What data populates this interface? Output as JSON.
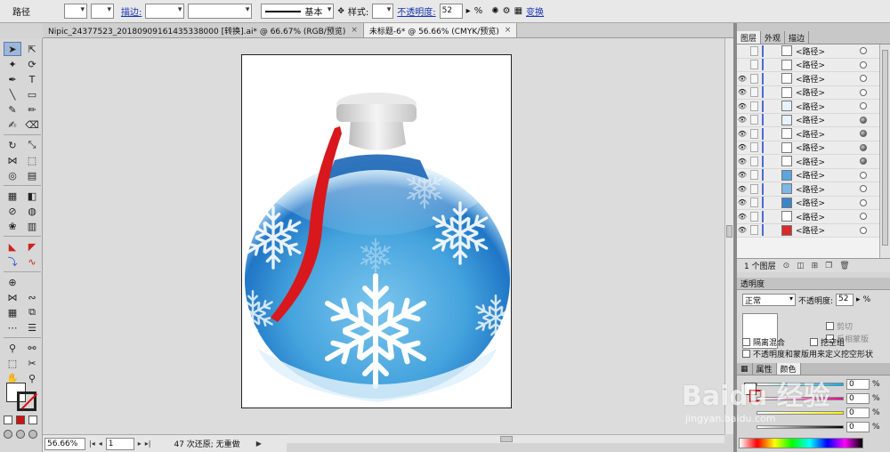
{
  "control_bar": {
    "selection_label": "路径",
    "stroke_label": "描边:",
    "stroke_profile": "基本",
    "style_label": "样式:",
    "opacity_label": "不透明度:",
    "opacity_value": "52",
    "opacity_unit": "%",
    "transform_link": "变换"
  },
  "tabs": [
    {
      "label": "Nipic_24377523_20180909161435338000 [转换].ai* @ 66.67% (RGB/预览)"
    },
    {
      "label": "未标题-6* @ 56.66% (CMYK/预览)"
    }
  ],
  "tab_close_glyph": "×",
  "layers_panel": {
    "tabs": [
      "图层",
      "外观",
      "描边"
    ],
    "item_label": "<路径>",
    "rows": [
      {
        "eye": false,
        "target_filled": false,
        "swatch": "#ffffff"
      },
      {
        "eye": false,
        "target_filled": false,
        "swatch": "#ffffff"
      },
      {
        "eye": true,
        "target_filled": false,
        "swatch": "#ffffff"
      },
      {
        "eye": true,
        "target_filled": false,
        "swatch": "#ffffff"
      },
      {
        "eye": true,
        "target_filled": false,
        "swatch": "#e8f2ff"
      },
      {
        "eye": true,
        "target_filled": true,
        "swatch": "#e8f2ff"
      },
      {
        "eye": true,
        "target_filled": true,
        "swatch": "#ffffff"
      },
      {
        "eye": true,
        "target_filled": true,
        "swatch": "#ffffff"
      },
      {
        "eye": true,
        "target_filled": true,
        "swatch": "#ffffff"
      },
      {
        "eye": true,
        "target_filled": false,
        "swatch": "#5aa6dd"
      },
      {
        "eye": true,
        "target_filled": false,
        "swatch": "#7ab8e6"
      },
      {
        "eye": true,
        "target_filled": false,
        "swatch": "#3b86c9"
      },
      {
        "eye": true,
        "target_filled": false,
        "swatch": "#ffffff"
      },
      {
        "eye": true,
        "target_filled": false,
        "swatch": "#d82b2b"
      }
    ],
    "footer_label": "1 个图层"
  },
  "transparency_panel": {
    "title": "透明度",
    "blend_mode": "正常",
    "opacity_label": "不透明度:",
    "opacity_value": "52",
    "opacity_unit": "%",
    "clip_label": "剪切",
    "invert_mask_label": "反相蒙版",
    "isolate_blend_label": "隔离混合",
    "knockout_group_label": "挖空组",
    "opacity_mask_label": "不透明度和蒙版用来定义挖空形状"
  },
  "color_panel": {
    "tabs": [
      "属性",
      "颜色"
    ],
    "channels": [
      {
        "value": "0",
        "color": "#00aeef"
      },
      {
        "value": "0",
        "color": "#ec008c"
      },
      {
        "value": "0",
        "color": "#fff200"
      },
      {
        "value": "0",
        "color": "#000000"
      }
    ],
    "unit": "%"
  },
  "status_bar": {
    "zoom": "56.66%",
    "artboard": "1",
    "status_text": "47 次还原; 无重做"
  },
  "watermark": {
    "text": "Baidu 经验",
    "url": "jingyan.baidu.com"
  },
  "colors": {
    "ornament_blue_dark": "#1c6fc0",
    "ornament_blue_light": "#8fd0f2",
    "ribbon_red": "#d8181c",
    "cap_gray": "#d8d8d8"
  }
}
